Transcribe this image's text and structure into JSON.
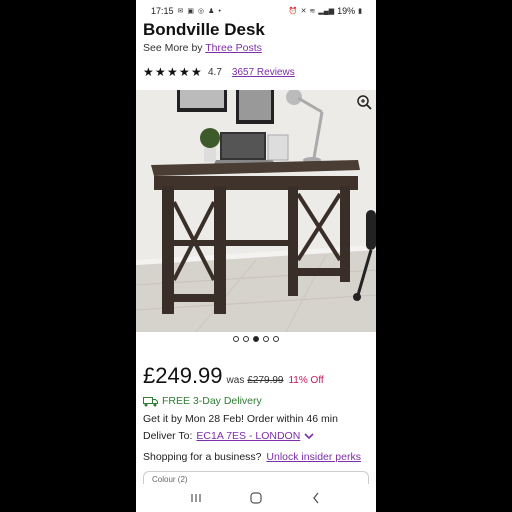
{
  "status": {
    "time": "17:15",
    "battery": "19%",
    "left_icons": [
      "mail-icon",
      "image-icon",
      "whatsapp-icon",
      "snapchat-icon",
      "dot-icon"
    ],
    "right_icons": [
      "alarm-icon",
      "mute-icon",
      "volte-icon",
      "signal-icon",
      "battery-icon"
    ]
  },
  "product": {
    "title": "Bondville Desk",
    "see_more_prefix": "See More by",
    "brand": "Three Posts",
    "rating": "4.7",
    "stars": 5,
    "reviews": "3657 Reviews"
  },
  "carousel": {
    "count": 5,
    "active_index": 2
  },
  "pricing": {
    "price": "£249.99",
    "was_label": "was",
    "was_price": "£279.99",
    "discount": "11% Off"
  },
  "shipping": {
    "free_delivery": "FREE 3-Day Delivery",
    "get_it": "Get it by Mon 28 Feb! Order within 46 min",
    "deliver_to_label": "Deliver To:",
    "postcode": "EC1A 7ES - LONDON"
  },
  "business": {
    "prompt": "Shopping for a business?",
    "link": "Unlock insider perks"
  },
  "options": {
    "colour_label": "Colour (2)"
  },
  "colors": {
    "link": "#7b2fa8",
    "discount": "#c2185b",
    "delivery": "#2e7d32"
  }
}
